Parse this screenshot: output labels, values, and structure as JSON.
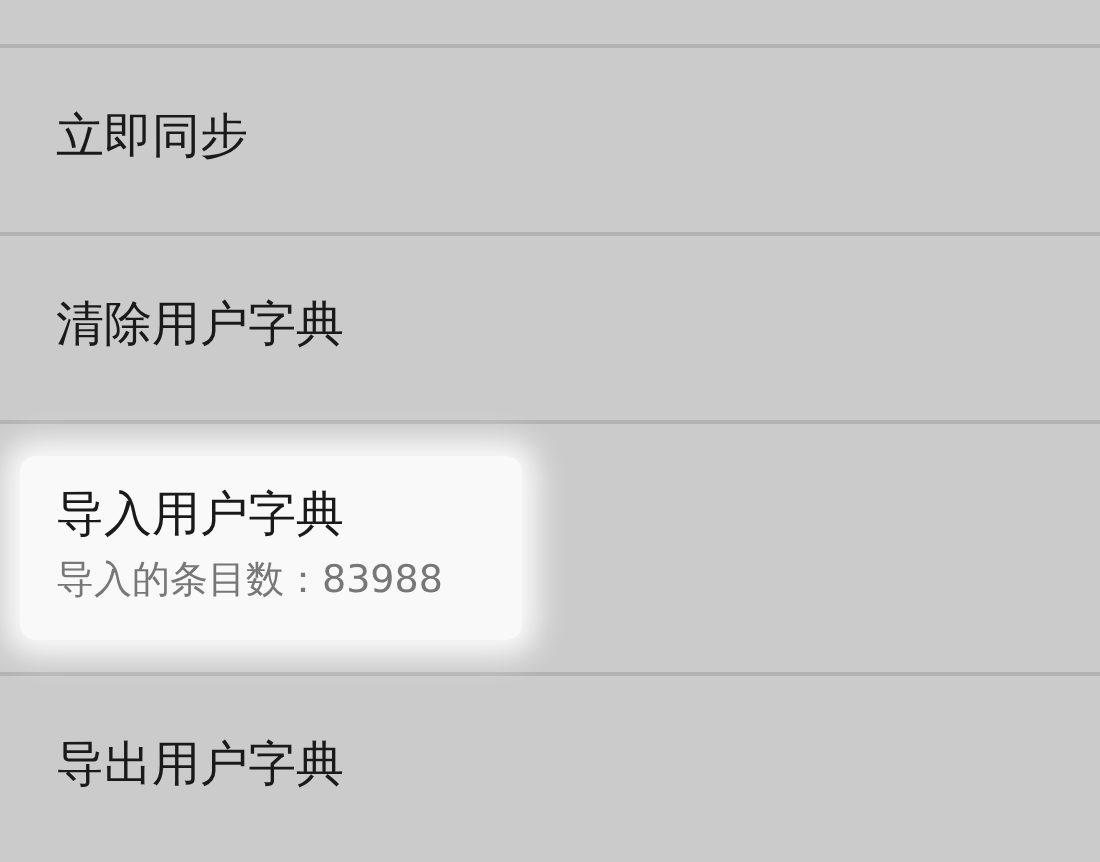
{
  "settings_items": [
    {
      "title": "立即同步",
      "selected": false
    },
    {
      "title": "清除用户字典",
      "selected": false
    },
    {
      "title": "导入用户字典",
      "summary": "导入的条目数：83988",
      "selected": true
    },
    {
      "title": "导出用户字典",
      "selected": false
    }
  ]
}
